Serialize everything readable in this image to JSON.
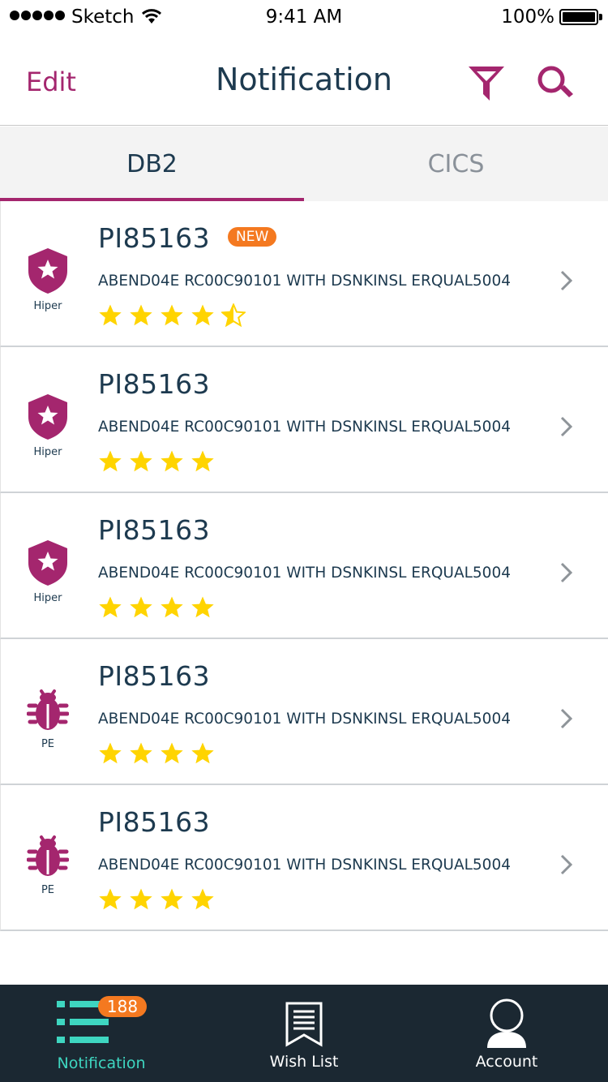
{
  "status_bar": {
    "carrier": "Sketch",
    "time": "9:41 AM",
    "battery": "100%"
  },
  "nav": {
    "edit_label": "Edit",
    "title": "Notification",
    "filter_icon": "filter-icon",
    "search_icon": "search-icon"
  },
  "tabs": [
    {
      "label": "DB2",
      "active": true
    },
    {
      "label": "CICS",
      "active": false
    }
  ],
  "items": [
    {
      "id": "PI85163",
      "badge": "NEW",
      "description": "ABEND04E RC00C90101 WITH DSNKINSL ERQUAL5004",
      "type_label": "Hiper",
      "type_icon": "shield-star-icon",
      "rating": 4.5
    },
    {
      "id": "PI85163",
      "badge": "",
      "description": "ABEND04E RC00C90101 WITH DSNKINSL ERQUAL5004",
      "type_label": "Hiper",
      "type_icon": "shield-star-icon",
      "rating": 4
    },
    {
      "id": "PI85163",
      "badge": "",
      "description": "ABEND04E RC00C90101 WITH DSNKINSL ERQUAL5004",
      "type_label": "Hiper",
      "type_icon": "shield-star-icon",
      "rating": 4
    },
    {
      "id": "PI85163",
      "badge": "",
      "description": "ABEND04E RC00C90101 WITH DSNKINSL ERQUAL5004",
      "type_label": "PE",
      "type_icon": "bug-icon",
      "rating": 4
    },
    {
      "id": "PI85163",
      "badge": "",
      "description": "ABEND04E RC00C90101 WITH DSNKINSL ERQUAL5004",
      "type_label": "PE",
      "type_icon": "bug-icon",
      "rating": 4
    }
  ],
  "tab_bar": [
    {
      "label": "Notification",
      "icon": "list-icon",
      "badge": "188",
      "active": true
    },
    {
      "label": "Wish List",
      "icon": "document-icon",
      "badge": "",
      "active": false
    },
    {
      "label": "Account",
      "icon": "user-icon",
      "badge": "",
      "active": false
    }
  ],
  "colors": {
    "accent": "#a4266e",
    "star": "#ffd400",
    "badge": "#f47920",
    "tab_bar_bg": "#1b2832",
    "tab_active": "#3ed6c0"
  }
}
